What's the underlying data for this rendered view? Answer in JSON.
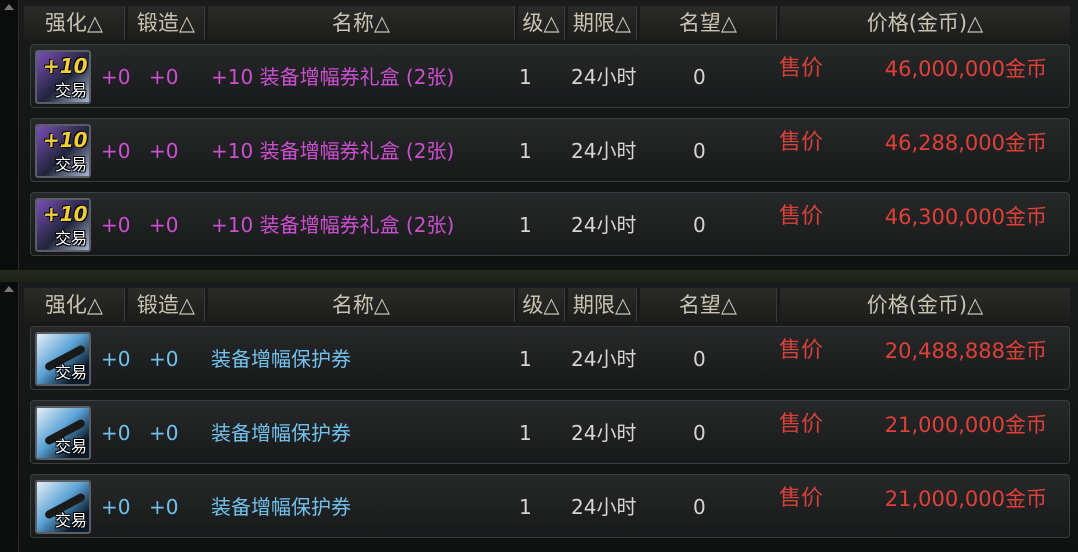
{
  "colors": {
    "purple": "#cc4fd0",
    "blue": "#72c1ec",
    "plain": "#d7d5cf",
    "red": "#e04038",
    "header": "#c9c3b2"
  },
  "header": {
    "enhance": "强化△",
    "forge": "锻造△",
    "name": "名称△",
    "level": "级△",
    "period": "期限△",
    "fame": "名望△",
    "price": "价格(金币)△"
  },
  "panels": [
    {
      "rows": [
        {
          "icon": "increase-ticket-icon",
          "badge": "+10",
          "trade": "交易",
          "enhance": "+0",
          "forge": "+0",
          "name": "+10 装备增幅券礼盒 (2张)",
          "level": "1",
          "period": "24小时",
          "fame": "0",
          "price_label": "售价",
          "price": "46,000,000金币",
          "color": "purple"
        },
        {
          "icon": "increase-ticket-icon",
          "badge": "+10",
          "trade": "交易",
          "enhance": "+0",
          "forge": "+0",
          "name": "+10 装备增幅券礼盒 (2张)",
          "level": "1",
          "period": "24小时",
          "fame": "0",
          "price_label": "售价",
          "price": "46,288,000金币",
          "color": "purple"
        },
        {
          "icon": "increase-ticket-icon",
          "badge": "+10",
          "trade": "交易",
          "enhance": "+0",
          "forge": "+0",
          "name": "+10 装备增幅券礼盒 (2张)",
          "level": "1",
          "period": "24小时",
          "fame": "0",
          "price_label": "售价",
          "price": "46,300,000金币",
          "color": "purple"
        }
      ]
    },
    {
      "rows": [
        {
          "icon": "protect-ticket-icon",
          "badge": "",
          "trade": "交易",
          "enhance": "+0",
          "forge": "+0",
          "name": "装备增幅保护券",
          "level": "1",
          "period": "24小时",
          "fame": "0",
          "price_label": "售价",
          "price": "20,488,888金币",
          "color": "blue"
        },
        {
          "icon": "protect-ticket-icon",
          "badge": "",
          "trade": "交易",
          "enhance": "+0",
          "forge": "+0",
          "name": "装备增幅保护券",
          "level": "1",
          "period": "24小时",
          "fame": "0",
          "price_label": "售价",
          "price": "21,000,000金币",
          "color": "blue"
        },
        {
          "icon": "protect-ticket-icon",
          "badge": "",
          "trade": "交易",
          "enhance": "+0",
          "forge": "+0",
          "name": "装备增幅保护券",
          "level": "1",
          "period": "24小时",
          "fame": "0",
          "price_label": "售价",
          "price": "21,000,000金币",
          "color": "blue"
        }
      ]
    }
  ]
}
